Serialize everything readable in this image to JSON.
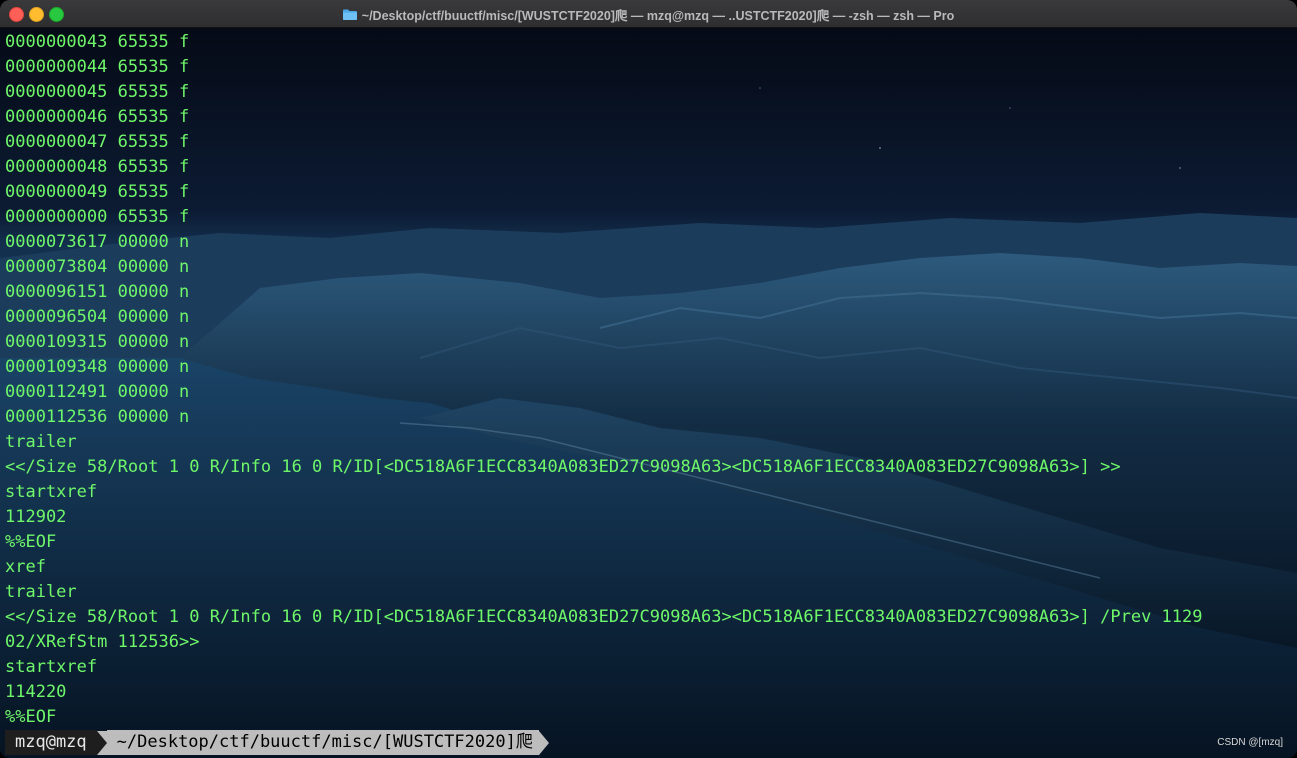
{
  "window": {
    "title": "~/Desktop/ctf/buuctf/misc/[WUSTCTF2020]爬 — mzq@mzq — ..USTCTF2020]爬 — -zsh — zsh — Pro",
    "folder_icon": "folder-icon",
    "traffic_lights": [
      "close",
      "minimize",
      "maximize"
    ]
  },
  "terminal": {
    "text_color": "#6ff76a",
    "lines": [
      "0000000043 65535 f",
      "0000000044 65535 f",
      "0000000045 65535 f",
      "0000000046 65535 f",
      "0000000047 65535 f",
      "0000000048 65535 f",
      "0000000049 65535 f",
      "0000000000 65535 f",
      "0000073617 00000 n",
      "0000073804 00000 n",
      "0000096151 00000 n",
      "0000096504 00000 n",
      "0000109315 00000 n",
      "0000109348 00000 n",
      "0000112491 00000 n",
      "0000112536 00000 n",
      "trailer",
      "<</Size 58/Root 1 0 R/Info 16 0 R/ID[<DC518A6F1ECC8340A083ED27C9098A63><DC518A6F1ECC8340A083ED27C9098A63>] >>",
      "startxref",
      "112902",
      "%%EOF",
      "xref",
      "trailer",
      "<</Size 58/Root 1 0 R/Info 16 0 R/ID[<DC518A6F1ECC8340A083ED27C9098A63><DC518A6F1ECC8340A083ED27C9098A63>] /Prev 1129",
      "02/XRefStm 112536>>",
      "startxref",
      "114220",
      "%%EOF"
    ]
  },
  "prompt": {
    "user": "mzq@mzq",
    "directory": "~/Desktop/ctf/buuctf/misc/[WUSTCTF2020]爬"
  },
  "watermark": "CSDN @[mzq]"
}
